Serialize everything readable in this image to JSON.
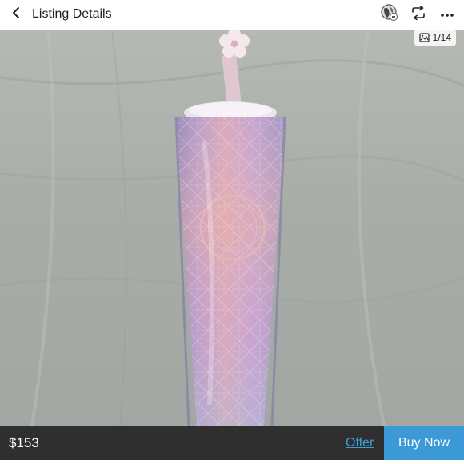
{
  "header": {
    "title": "Listing Details",
    "icons": [
      "back-icon",
      "avatar-icon",
      "repost-icon",
      "more-icon"
    ]
  },
  "photo": {
    "counter": "1/14",
    "counter_icon": "gallery-icon"
  },
  "bottom_bar": {
    "price": "$153",
    "offer_label": "Offer",
    "buy_label": "Buy Now",
    "colors": {
      "bar": "#2f2f2f",
      "accent": "#3b99d6"
    }
  }
}
